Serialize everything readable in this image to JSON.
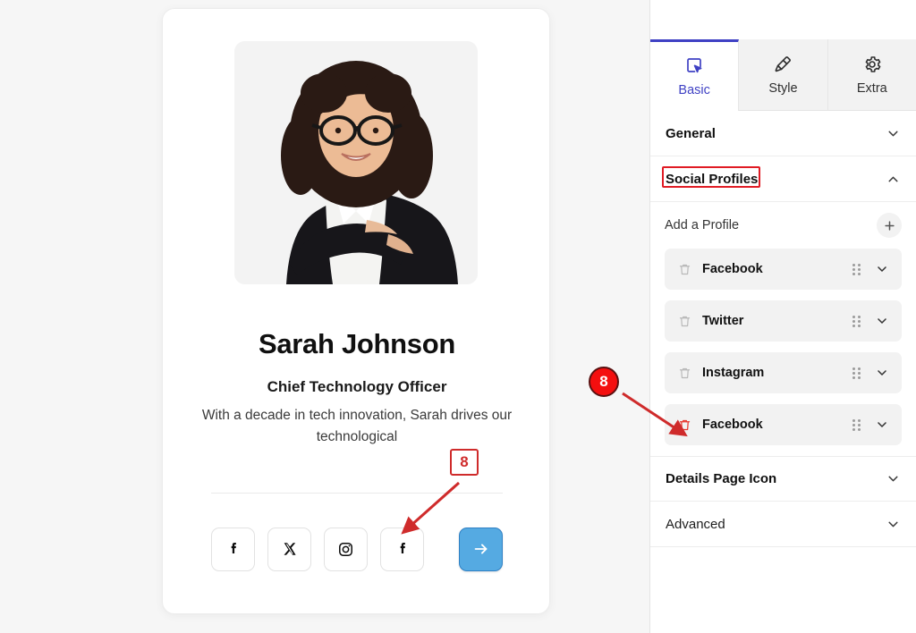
{
  "preview": {
    "card": {
      "avatar_alt": "portrait-woman-curly-hair-glasses-black-blazer",
      "name": "Sarah Johnson",
      "role": "Chief Technology Officer",
      "bio": "With a decade in tech innovation, Sarah drives our technological",
      "social_icons": [
        {
          "name": "facebook",
          "glyph": "f"
        },
        {
          "name": "x-twitter",
          "glyph": "X"
        },
        {
          "name": "instagram",
          "glyph": "instagram"
        },
        {
          "name": "facebook",
          "glyph": "f"
        }
      ],
      "next_button": {
        "icon": "arrow-right-icon",
        "color": "#55aae2"
      }
    }
  },
  "panel": {
    "tabs": [
      {
        "label": "Basic",
        "icon": "cursor-select-icon",
        "active": true
      },
      {
        "label": "Style",
        "icon": "paint-brush-icon",
        "active": false
      },
      {
        "label": "Extra",
        "icon": "gear-icon",
        "active": false
      }
    ],
    "sections": [
      {
        "label": "General",
        "state": "collapsed",
        "bold": true,
        "highlight": false
      },
      {
        "label": "Social Profiles",
        "state": "expanded",
        "bold": true,
        "highlight": true
      }
    ],
    "social_profiles": {
      "add_label": "Add a Profile",
      "add_icon": "plus-icon",
      "items": [
        {
          "label": "Facebook",
          "delete_icon": "trash-icon",
          "delete_active": false,
          "drag_icon": "drag-handle-icon",
          "chevron": "chevron-down-icon"
        },
        {
          "label": "Twitter",
          "delete_icon": "trash-icon",
          "delete_active": false,
          "drag_icon": "drag-handle-icon",
          "chevron": "chevron-down-icon"
        },
        {
          "label": "Instagram",
          "delete_icon": "trash-icon",
          "delete_active": false,
          "drag_icon": "drag-handle-icon",
          "chevron": "chevron-down-icon"
        },
        {
          "label": "Facebook",
          "delete_icon": "trash-icon",
          "delete_active": true,
          "drag_icon": "drag-handle-icon",
          "chevron": "chevron-down-icon"
        }
      ]
    },
    "bottom_sections": [
      {
        "label": "Details Page Icon",
        "state": "collapsed",
        "bold": true
      },
      {
        "label": "Advanced",
        "state": "collapsed",
        "bold": false
      }
    ]
  },
  "annotations": {
    "step_box": {
      "number": "8",
      "shape": "square"
    },
    "step_circle": {
      "number": "8",
      "shape": "circle"
    },
    "accent_color": "#cf2b2b",
    "circle_color": "#f40f0f",
    "active_tab_color": "#3f41c4"
  }
}
